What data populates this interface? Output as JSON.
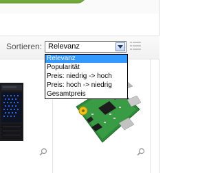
{
  "sort": {
    "label": "Sortieren:",
    "selected_value": "Relevanz",
    "options": [
      "Relevanz",
      "Popularität",
      "Preis: niedrig -> hoch",
      "Preis: hoch -> niedrig",
      "Gesamtpreis"
    ],
    "highlighted_index": 0
  },
  "icons": {
    "dropdown_arrow": "chevron-down-icon",
    "list_view": "list-view-icon",
    "zoom": "magnifier-icon"
  },
  "colors": {
    "accent_green": "#7cb342",
    "selection_blue": "#3399ff"
  }
}
